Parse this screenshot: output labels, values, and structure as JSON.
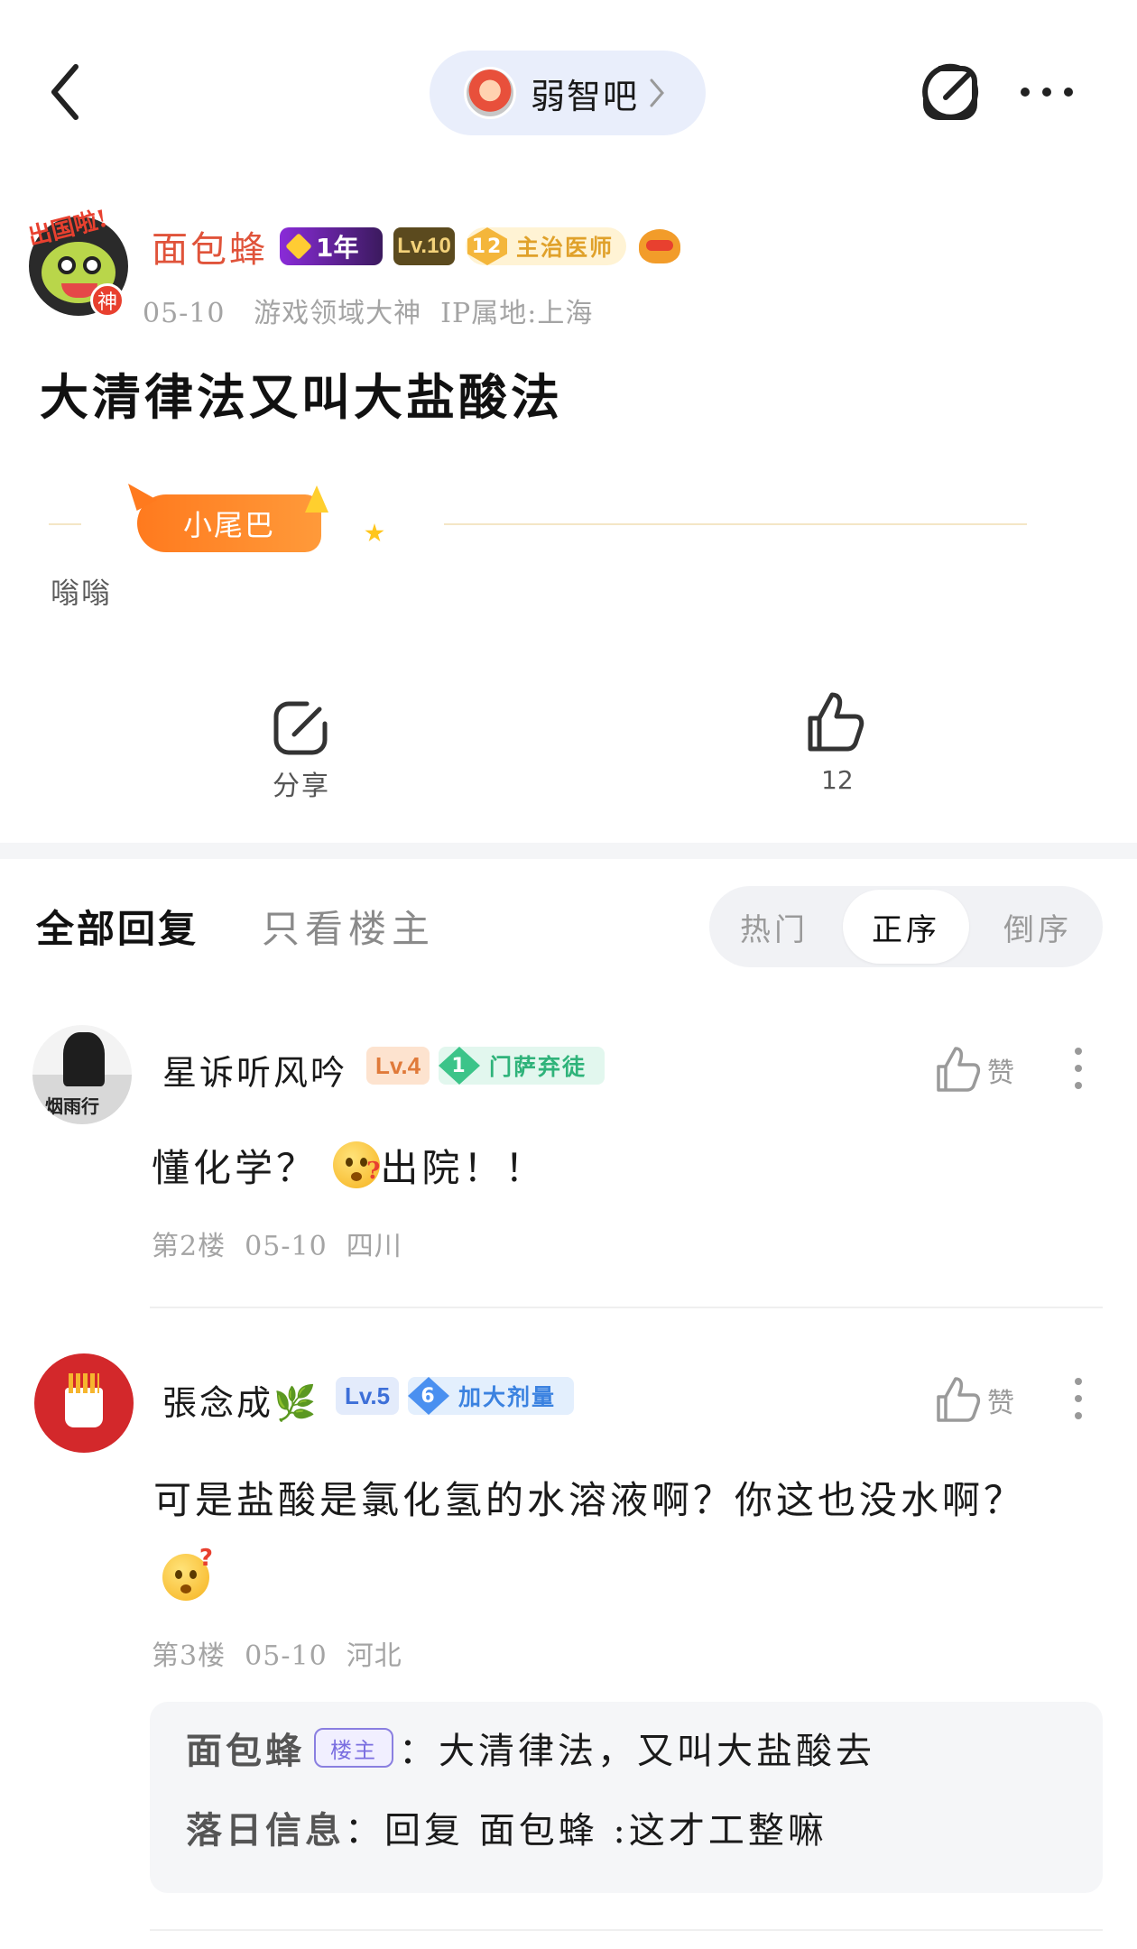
{
  "header": {
    "forum_name": "弱智吧"
  },
  "post": {
    "author": "面包蜂",
    "god_badge": "神",
    "avatar_sticker": "出国啦!",
    "badges": {
      "year": "1年",
      "level": "Lv.10",
      "title_level": "12",
      "title": "主治医师"
    },
    "date": "05-10",
    "domain": "游戏领域大神",
    "ip": "IP属地:上海",
    "title": "大清律法又叫大盐酸法",
    "tail_badge": "小尾巴",
    "tail_text": "嗡嗡",
    "share_label": "分享",
    "like_count": "12"
  },
  "tabs": {
    "all": "全部回复",
    "op_only": "只看楼主",
    "sort": [
      "热门",
      "正序",
      "倒序"
    ],
    "sort_selected": "正序"
  },
  "comments": [
    {
      "name": "星诉听风吟",
      "level": "Lv.4",
      "title_level": "1",
      "title": "门萨弃徒",
      "text_before": "懂化学？",
      "text_after": "出院！！",
      "floor": "第2楼",
      "date": "05-10",
      "location": "四川",
      "like_label": "赞"
    },
    {
      "name": "張念成🌿",
      "level": "Lv.5",
      "title_level": "6",
      "title": "加大剂量",
      "text": "可是盐酸是氯化氢的水溶液啊？你这也没水啊？",
      "floor": "第3楼",
      "date": "05-10",
      "location": "河北",
      "like_label": "赞",
      "replies": [
        {
          "who": "面包蜂",
          "tag": "楼主",
          "text": "：大清律法，又叫大盐酸去"
        },
        {
          "who": "落日信息",
          "text": "：回复 面包蜂 :这才工整嘛"
        }
      ]
    }
  ],
  "colors": {
    "accent": "#e0533a",
    "tail_orange": "#ff7a1e",
    "reply_bg": "#f5f6f8"
  },
  "icons": [
    "back-icon",
    "chevron-right-icon",
    "share-icon",
    "more-icon",
    "thumbs-up-icon",
    "vertical-more-icon"
  ]
}
